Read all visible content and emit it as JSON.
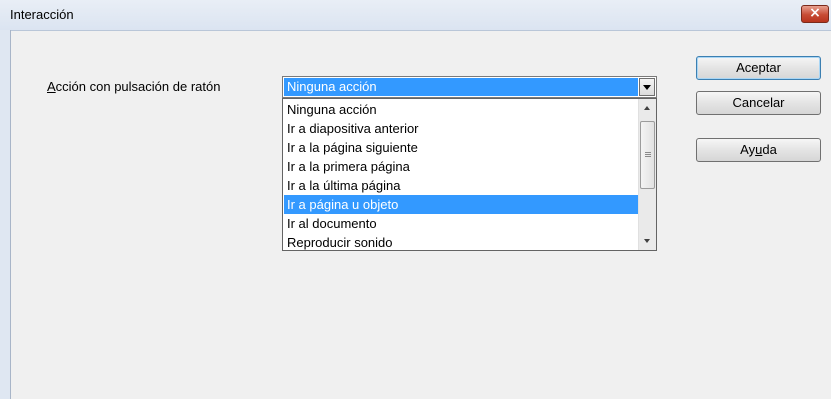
{
  "window": {
    "title": "Interacción"
  },
  "field": {
    "label_prefix": "A",
    "label_rest": "cción con pulsación de ratón",
    "selected_value": "Ninguna acción"
  },
  "dropdown": {
    "options": [
      "Ninguna acción",
      "Ir a diapositiva anterior",
      "Ir a la página siguiente",
      "Ir a la primera página",
      "Ir a la última página",
      "Ir a página u objeto",
      "Ir al documento",
      "Reproducir sonido"
    ],
    "highlighted_index": 5
  },
  "buttons": {
    "ok": "Aceptar",
    "cancel": "Cancelar",
    "help_prefix": "Ay",
    "help_mnemonic": "u",
    "help_suffix": "da"
  },
  "icons": {
    "close": "close-icon",
    "dropdown_arrow": "chevron-down-icon",
    "scroll_up": "scroll-up-arrow-icon",
    "scroll_down": "scroll-down-arrow-icon"
  }
}
